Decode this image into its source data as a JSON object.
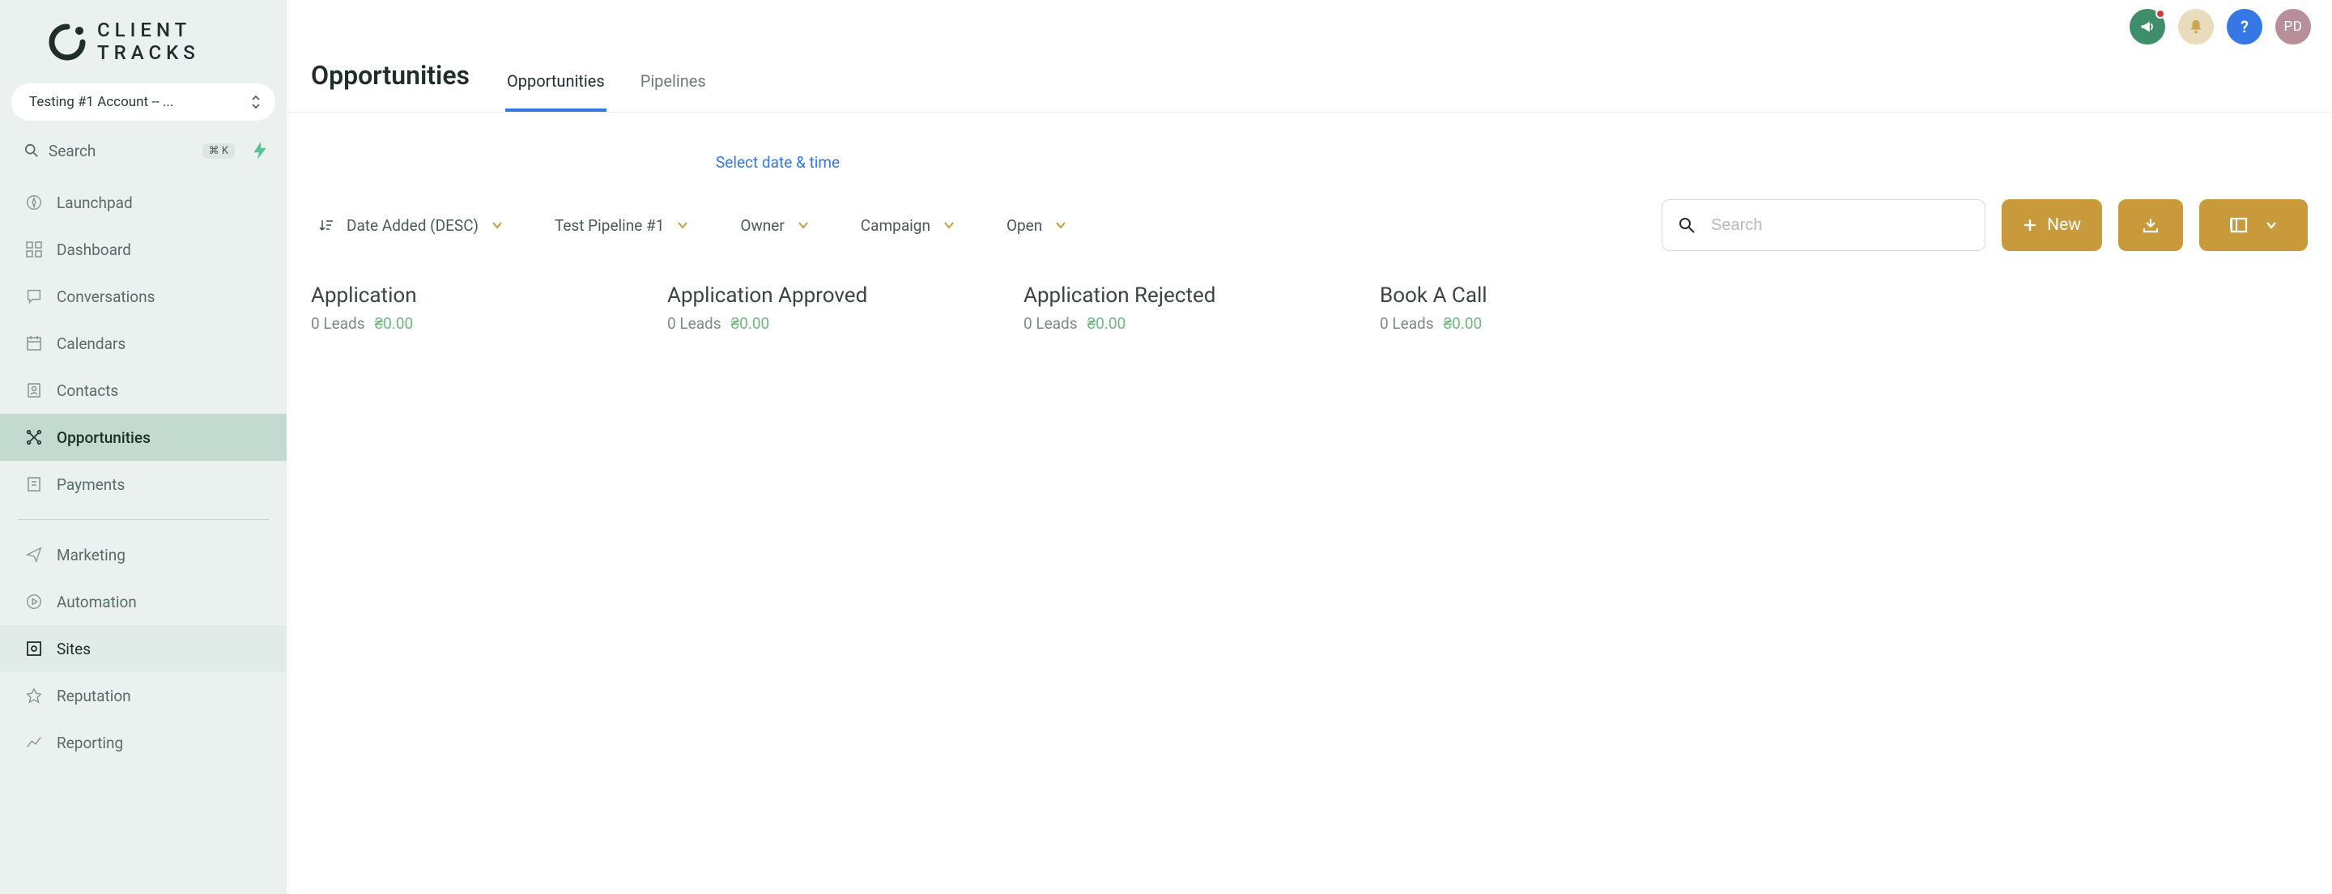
{
  "brand": {
    "line1": "CLIENT",
    "line2": "TRACKS"
  },
  "account_switcher": {
    "label": "Testing #1 Account -- ..."
  },
  "sidebar_search": {
    "placeholder": "Search",
    "shortcut": "⌘ K"
  },
  "nav": {
    "launchpad": "Launchpad",
    "dashboard": "Dashboard",
    "conversations": "Conversations",
    "calendars": "Calendars",
    "contacts": "Contacts",
    "opportunities": "Opportunities",
    "payments": "Payments",
    "marketing": "Marketing",
    "automation": "Automation",
    "sites": "Sites",
    "reputation": "Reputation",
    "reporting": "Reporting"
  },
  "topbar": {
    "avatar_initials": "PD",
    "help_glyph": "?"
  },
  "page_title": "Opportunities",
  "tabs": {
    "opportunities": "Opportunities",
    "pipelines": "Pipelines"
  },
  "date_link": "Select date & time",
  "filters": {
    "sort": "Date Added (DESC)",
    "pipeline": "Test Pipeline #1",
    "owner": "Owner",
    "campaign": "Campaign",
    "status": "Open"
  },
  "toolbar": {
    "search_placeholder": "Search",
    "new_label": "New"
  },
  "columns": [
    {
      "title": "Application",
      "leads": "0 Leads",
      "amount": "₴0.00"
    },
    {
      "title": "Application Approved",
      "leads": "0 Leads",
      "amount": "₴0.00"
    },
    {
      "title": "Application Rejected",
      "leads": "0 Leads",
      "amount": "₴0.00"
    },
    {
      "title": "Book A Call",
      "leads": "0 Leads",
      "amount": "₴0.00"
    }
  ]
}
